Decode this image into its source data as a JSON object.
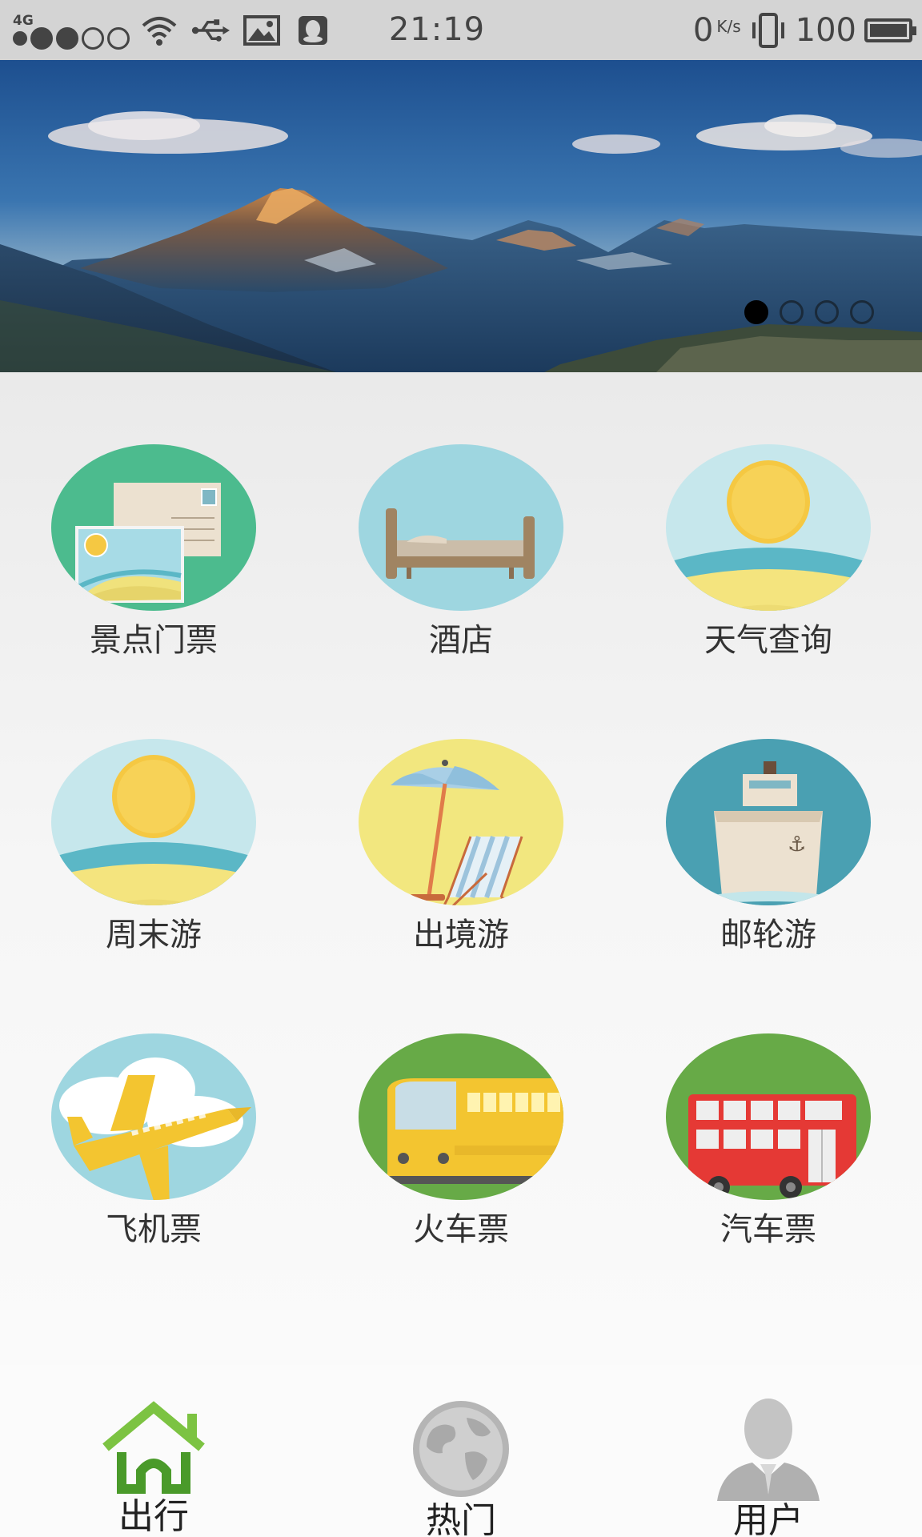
{
  "status_bar": {
    "network": "4G",
    "time": "21:19",
    "speed": "0",
    "speed_unit": "K/s",
    "battery": "100"
  },
  "banner": {
    "page_count": 4,
    "active_page": 1
  },
  "grid": {
    "items": [
      {
        "label": "景点门票",
        "icon": "postcard-icon",
        "bg": "#4cbb8e"
      },
      {
        "label": "酒店",
        "icon": "bed-icon",
        "bg": "#9ed6e0"
      },
      {
        "label": "天气查询",
        "icon": "sun-beach-icon",
        "bg": "#c6e7ec"
      },
      {
        "label": "周末游",
        "icon": "sun-beach-icon",
        "bg": "#c6e7ec"
      },
      {
        "label": "出境游",
        "icon": "beach-umbrella-icon",
        "bg": "#f2e77f"
      },
      {
        "label": "邮轮游",
        "icon": "cruise-ship-icon",
        "bg": "#4aa0b2"
      },
      {
        "label": "飞机票",
        "icon": "airplane-icon",
        "bg": "#9ed6e0"
      },
      {
        "label": "火车票",
        "icon": "train-icon",
        "bg": "#67aa47"
      },
      {
        "label": "汽车票",
        "icon": "bus-icon",
        "bg": "#67aa47"
      }
    ]
  },
  "bottom_nav": {
    "items": [
      {
        "label": "出行",
        "icon": "home-icon",
        "active": true
      },
      {
        "label": "热门",
        "icon": "globe-icon",
        "active": false
      },
      {
        "label": "用户",
        "icon": "user-icon",
        "active": false
      }
    ]
  },
  "colors": {
    "active_nav": "#7cc342",
    "inactive_nav": "#b5b5b5"
  }
}
